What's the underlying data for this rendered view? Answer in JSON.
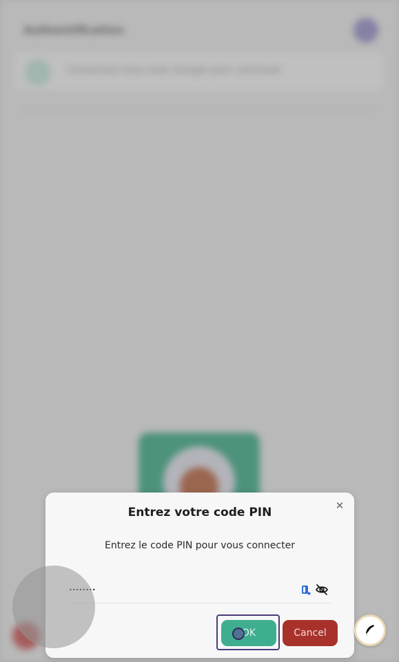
{
  "background": {
    "title": "Authentification",
    "card_text": "Connectez-vous avec Google pour continuer"
  },
  "dialog": {
    "title": "Entrez votre code PIN",
    "subtitle": "Entrez le code PIN pour vous connecter",
    "pin_value": "••••••••",
    "ok_label": "OK",
    "cancel_label": "Cancel",
    "close_symbol": "✕"
  },
  "icons": {
    "close": "close-icon",
    "password_manager": "password-manager-icon",
    "visibility": "eye-slash-icon",
    "fab": "feather-icon"
  },
  "colors": {
    "ok": "#3fae8f",
    "cancel": "#a8322b",
    "focus_ring": "#4b3a78"
  }
}
